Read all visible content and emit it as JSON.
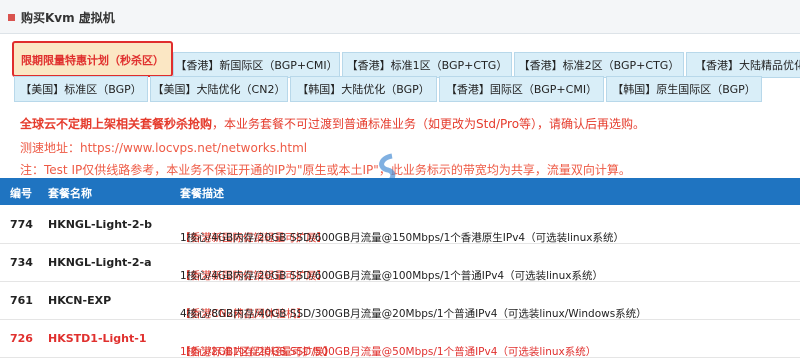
{
  "header": {
    "title": "购买Kvm 虚拟机"
  },
  "tabs_row1": [
    "限期限量特惠计划（秒杀区）",
    "【香港】新国际区（BGP+CMI）",
    "【香港】标准1区（BGP+CTG）",
    "【香港】标准2区（BGP+CTG）",
    "【香港】大陆精品优化"
  ],
  "tabs_row2": [
    "【美国】标准区（BGP）",
    "【美国】大陆优化（CN2）",
    "【韩国】大陆优化（BGP）",
    "【香港】国际区（BGP+CMI）",
    "【韩国】原生国际区（BGP）"
  ],
  "notices": {
    "line1_bold": "全球云不定期上架相关套餐秒杀抢购",
    "line1_rest": "，本业务套餐不可过渡到普通标准业务（如更改为Std/Pro等），请确认后再选购。",
    "line2": "测速地址：https://www.locvps.net/networks.html",
    "line3": "注：Test IP仅供线路参考，本业务不保证开通的IP为\"原生或本土IP\"，此业务标示的带宽均为共享，流量双向计算。"
  },
  "table": {
    "headers": {
      "id": "编号",
      "name": "套餐名称",
      "desc": "套餐描述"
    },
    "rows": [
      {
        "id": "774",
        "name": "HKNGL-Light-2-b",
        "desc_pre": "【香港新国际促销轻量可扩展】",
        "desc": "1核心/4GB内存/20GB SSD/600GB月流量@150Mbps/1个香港原生IPv4（可选装linux系统）"
      },
      {
        "id": "734",
        "name": "HKNGL-Light-2-a",
        "desc_pre": "【香港新国际促销轻量可扩展】",
        "desc": "1核心/4GB内存/20GB SSD/600GB月流量@100Mbps/1个普通IPv4（可选装linux系统）"
      },
      {
        "id": "761",
        "name": "HKCN-EXP",
        "desc_pre": "【香港CN2精品网体验机】",
        "desc": "4核心/8GB内存/40GB SSD/300GB月流量@20Mbps/1个普通IPv4（可选装linux/Windows系统）"
      },
      {
        "id": "726",
        "name": "HKSTD1-Light-1",
        "desc_pre": "【香港标准1区促销轻量可扩展】",
        "desc": "1核心/2GB内存/20GB SSD/500GB月流量@50Mbps/1个普通IPv4（可选装linux系统）"
      }
    ]
  },
  "colors": {
    "header_bar": "#1f74c1",
    "accent_red": "#e0302e",
    "tab_bg": "#d9eef8"
  }
}
